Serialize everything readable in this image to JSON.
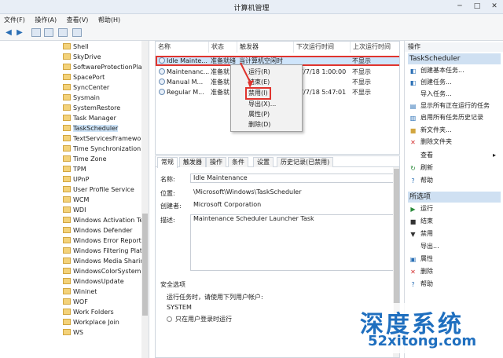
{
  "window": {
    "title": "计算机管理",
    "controls": [
      "─",
      "□",
      "✕"
    ]
  },
  "menu": [
    "文件(F)",
    "操作(A)",
    "查看(V)",
    "帮助(H)"
  ],
  "tree": {
    "items": [
      "Shell",
      "SkyDrive",
      "SoftwareProtectionPlatf",
      "SpacePort",
      "SyncCenter",
      "Sysmain",
      "SystemRestore",
      "Task Manager",
      "TaskScheduler",
      "TextServicesFramework",
      "Time Synchronization",
      "Time Zone",
      "TPM",
      "UPnP",
      "User Profile Service",
      "WCM",
      "WDI",
      "Windows Activation Tec",
      "Windows Defender",
      "Windows Error Reporti",
      "Windows Filtering Platf",
      "Windows Media Sharin",
      "WindowsColorSystem",
      "WindowsUpdate",
      "Wininet",
      "WOF",
      "Work Folders",
      "Workplace Join",
      "WS"
    ],
    "selected": "TaskScheduler"
  },
  "tasks": {
    "columns": [
      "名称",
      "状态",
      "触发器",
      "下次运行时间",
      "上次运行时间"
    ],
    "rows": [
      {
        "name": "Idle Mainte...",
        "status": "准备就绪",
        "trigger": "当计算机空闲时",
        "next": "",
        "last": "不显示"
      },
      {
        "name": "Maintenanc...",
        "status": "准备就",
        "trigger": "",
        "next": "17/7/18 1:00:00",
        "last": "不显示"
      },
      {
        "name": "Manual M...",
        "status": "准备就",
        "trigger": "",
        "next": "",
        "last": "不显示"
      },
      {
        "name": "Regular M...",
        "status": "准备就",
        "trigger": "",
        "next": "17/7/18 5:47:01",
        "last": "不显示"
      }
    ]
  },
  "context_menu": {
    "items": [
      "运行(R)",
      "结束(E)",
      "禁用(I)",
      "导出(X)...",
      "属性(P)",
      "删除(D)"
    ],
    "highlighted": "禁用(I)"
  },
  "detail": {
    "tabs": [
      "常规",
      "触发器",
      "操作",
      "条件",
      "设置",
      "历史记录(已禁用)"
    ],
    "fields": [
      {
        "label": "名称:",
        "value": "Idle Maintenance"
      },
      {
        "label": "位置:",
        "value": "\\Microsoft\\Windows\\TaskScheduler"
      },
      {
        "label": "创建者:",
        "value": "Microsoft Corporation"
      },
      {
        "label": "描述:",
        "value": "Maintenance Scheduler Launcher Task"
      }
    ],
    "security": {
      "title": "安全选项",
      "run_as_label": "运行任务时，请使用下列用户帐户:",
      "account": "SYSTEM",
      "option1": "只在用户登录时运行"
    }
  },
  "actions": {
    "header1": "操作",
    "group1": "TaskScheduler",
    "group1_items": [
      "创建基本任务...",
      "创建任务...",
      "导入任务...",
      "显示所有正在运行的任务",
      "启用所有任务历史记录",
      "新文件夹...",
      "删除文件夹",
      "查看",
      "刷新",
      "帮助"
    ],
    "header2": "所选项",
    "group2_items": [
      "运行",
      "结束",
      "禁用",
      "导出...",
      "属性",
      "删除",
      "帮助"
    ]
  },
  "watermark": {
    "main": "深度系统",
    "url": "52xitong.com"
  },
  "colors": {
    "highlight": "#e0342e",
    "selection": "#cfe5fb",
    "accent": "#1f6fbf"
  }
}
